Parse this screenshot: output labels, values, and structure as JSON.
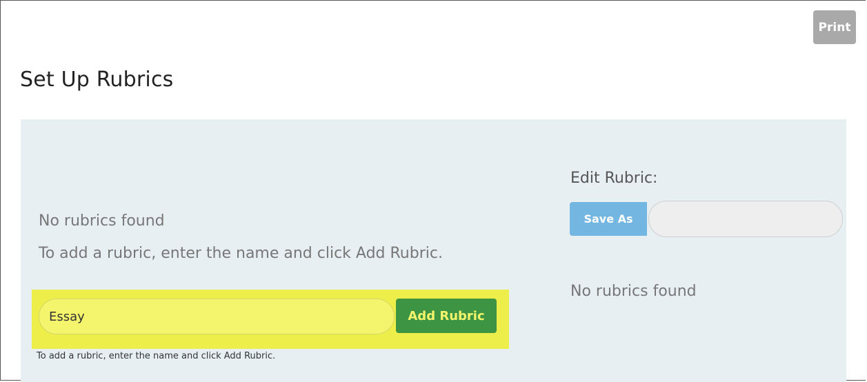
{
  "toolbar": {
    "print_label": "Print"
  },
  "page": {
    "title": "Set Up Rubrics"
  },
  "left": {
    "no_rubrics": "No rubrics found",
    "instructions": "To add a rubric, enter the name and click Add Rubric.",
    "rubric_name_value": "Essay",
    "add_button_label": "Add Rubric",
    "help_text": "To add a rubric, enter the name and click Add Rubric."
  },
  "right": {
    "edit_label": "Edit Rubric:",
    "save_as_label": "Save As",
    "save_as_value": "",
    "no_rubrics": "No rubrics found"
  },
  "colors": {
    "highlight": "#eeee4a",
    "add_button": "#3d9443",
    "save_as_button": "#74b6e2",
    "print_button": "#a9a9a9",
    "panel_background": "#e7eff3"
  }
}
